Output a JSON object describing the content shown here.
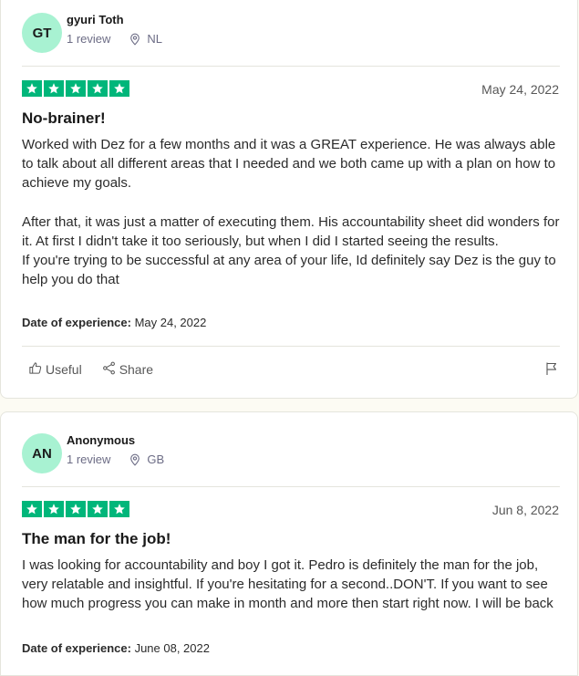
{
  "reviews": [
    {
      "initials": "GT",
      "name": "gyuri Toth",
      "review_count": "1 review",
      "country": "NL",
      "rating": 5,
      "date": "May 24, 2022",
      "title": "No-brainer!",
      "paragraphs": [
        "Worked with Dez for a few months and it was a GREAT experience. He was always able to talk about all different areas that I needed and we both came up with a plan on how to achieve my goals.",
        "After that, it was just a matter of executing them. His accountability sheet did wonders for it. At first I didn't take it too seriously, but when I did I started seeing the results.",
        "If you're trying to be successful at any area of your life, Id definitely say Dez is the guy to help you do that"
      ],
      "experience_label": "Date of experience:",
      "experience_date": "May 24, 2022",
      "useful_label": "Useful",
      "share_label": "Share"
    },
    {
      "initials": "AN",
      "name": "Anonymous",
      "review_count": "1 review",
      "country": "GB",
      "rating": 5,
      "date": "Jun 8, 2022",
      "title": "The man for the job!",
      "paragraphs": [
        "I was looking for accountability and boy I got it. Pedro is definitely the man for the job, very relatable and insightful. If you're hesitating for a second..DON'T. If you want to see how much progress you can make in month and more then start right now. I will be back"
      ],
      "experience_label": "Date of experience:",
      "experience_date": "June 08, 2022"
    }
  ],
  "colors": {
    "star_green": "#00b67a",
    "avatar_bg": "#a8f2d2",
    "page_bg": "#fcfbf3"
  },
  "icons": {
    "location": "location-pin-icon",
    "star": "star-icon",
    "useful": "thumbs-up-icon",
    "share": "share-icon",
    "report": "flag-icon"
  }
}
